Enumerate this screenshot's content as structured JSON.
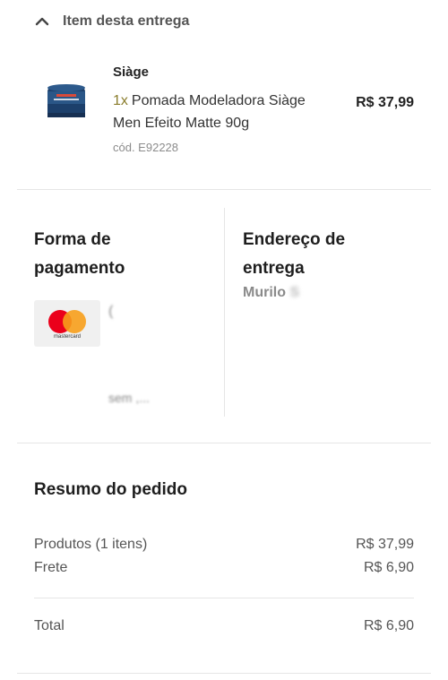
{
  "delivery": {
    "header_label": "Item desta entrega",
    "header_icon": "chevron-up-icon",
    "item": {
      "brand": "Siàge",
      "quantity": "1x",
      "name": "Pomada Modeladora Siàge Men Efeito Matte 90g",
      "price": "R$ 37,99",
      "code": "cód. E92228"
    }
  },
  "payment": {
    "title_line1": "Forma de",
    "title_line2": "pagamento",
    "card_brand": "mastercard",
    "card_partial_text": "(",
    "installment_partial": "sem ,..."
  },
  "address": {
    "title_line1": "Endereço de",
    "title_line2": "entrega",
    "recipient_partial": "Murilo",
    "recipient_faded": "S"
  },
  "summary": {
    "title": "Resumo do pedido",
    "products_label": "Produtos (1 itens)",
    "products_value": "R$ 37,99",
    "shipping_label": "Frete",
    "shipping_value": "R$ 6,90",
    "total_label": "Total",
    "total_value": "R$ 6,90"
  },
  "colors": {
    "quantity_accent": "#8a7d2c",
    "mastercard_red": "#eb001b",
    "mastercard_yellow": "#f79e1b"
  }
}
